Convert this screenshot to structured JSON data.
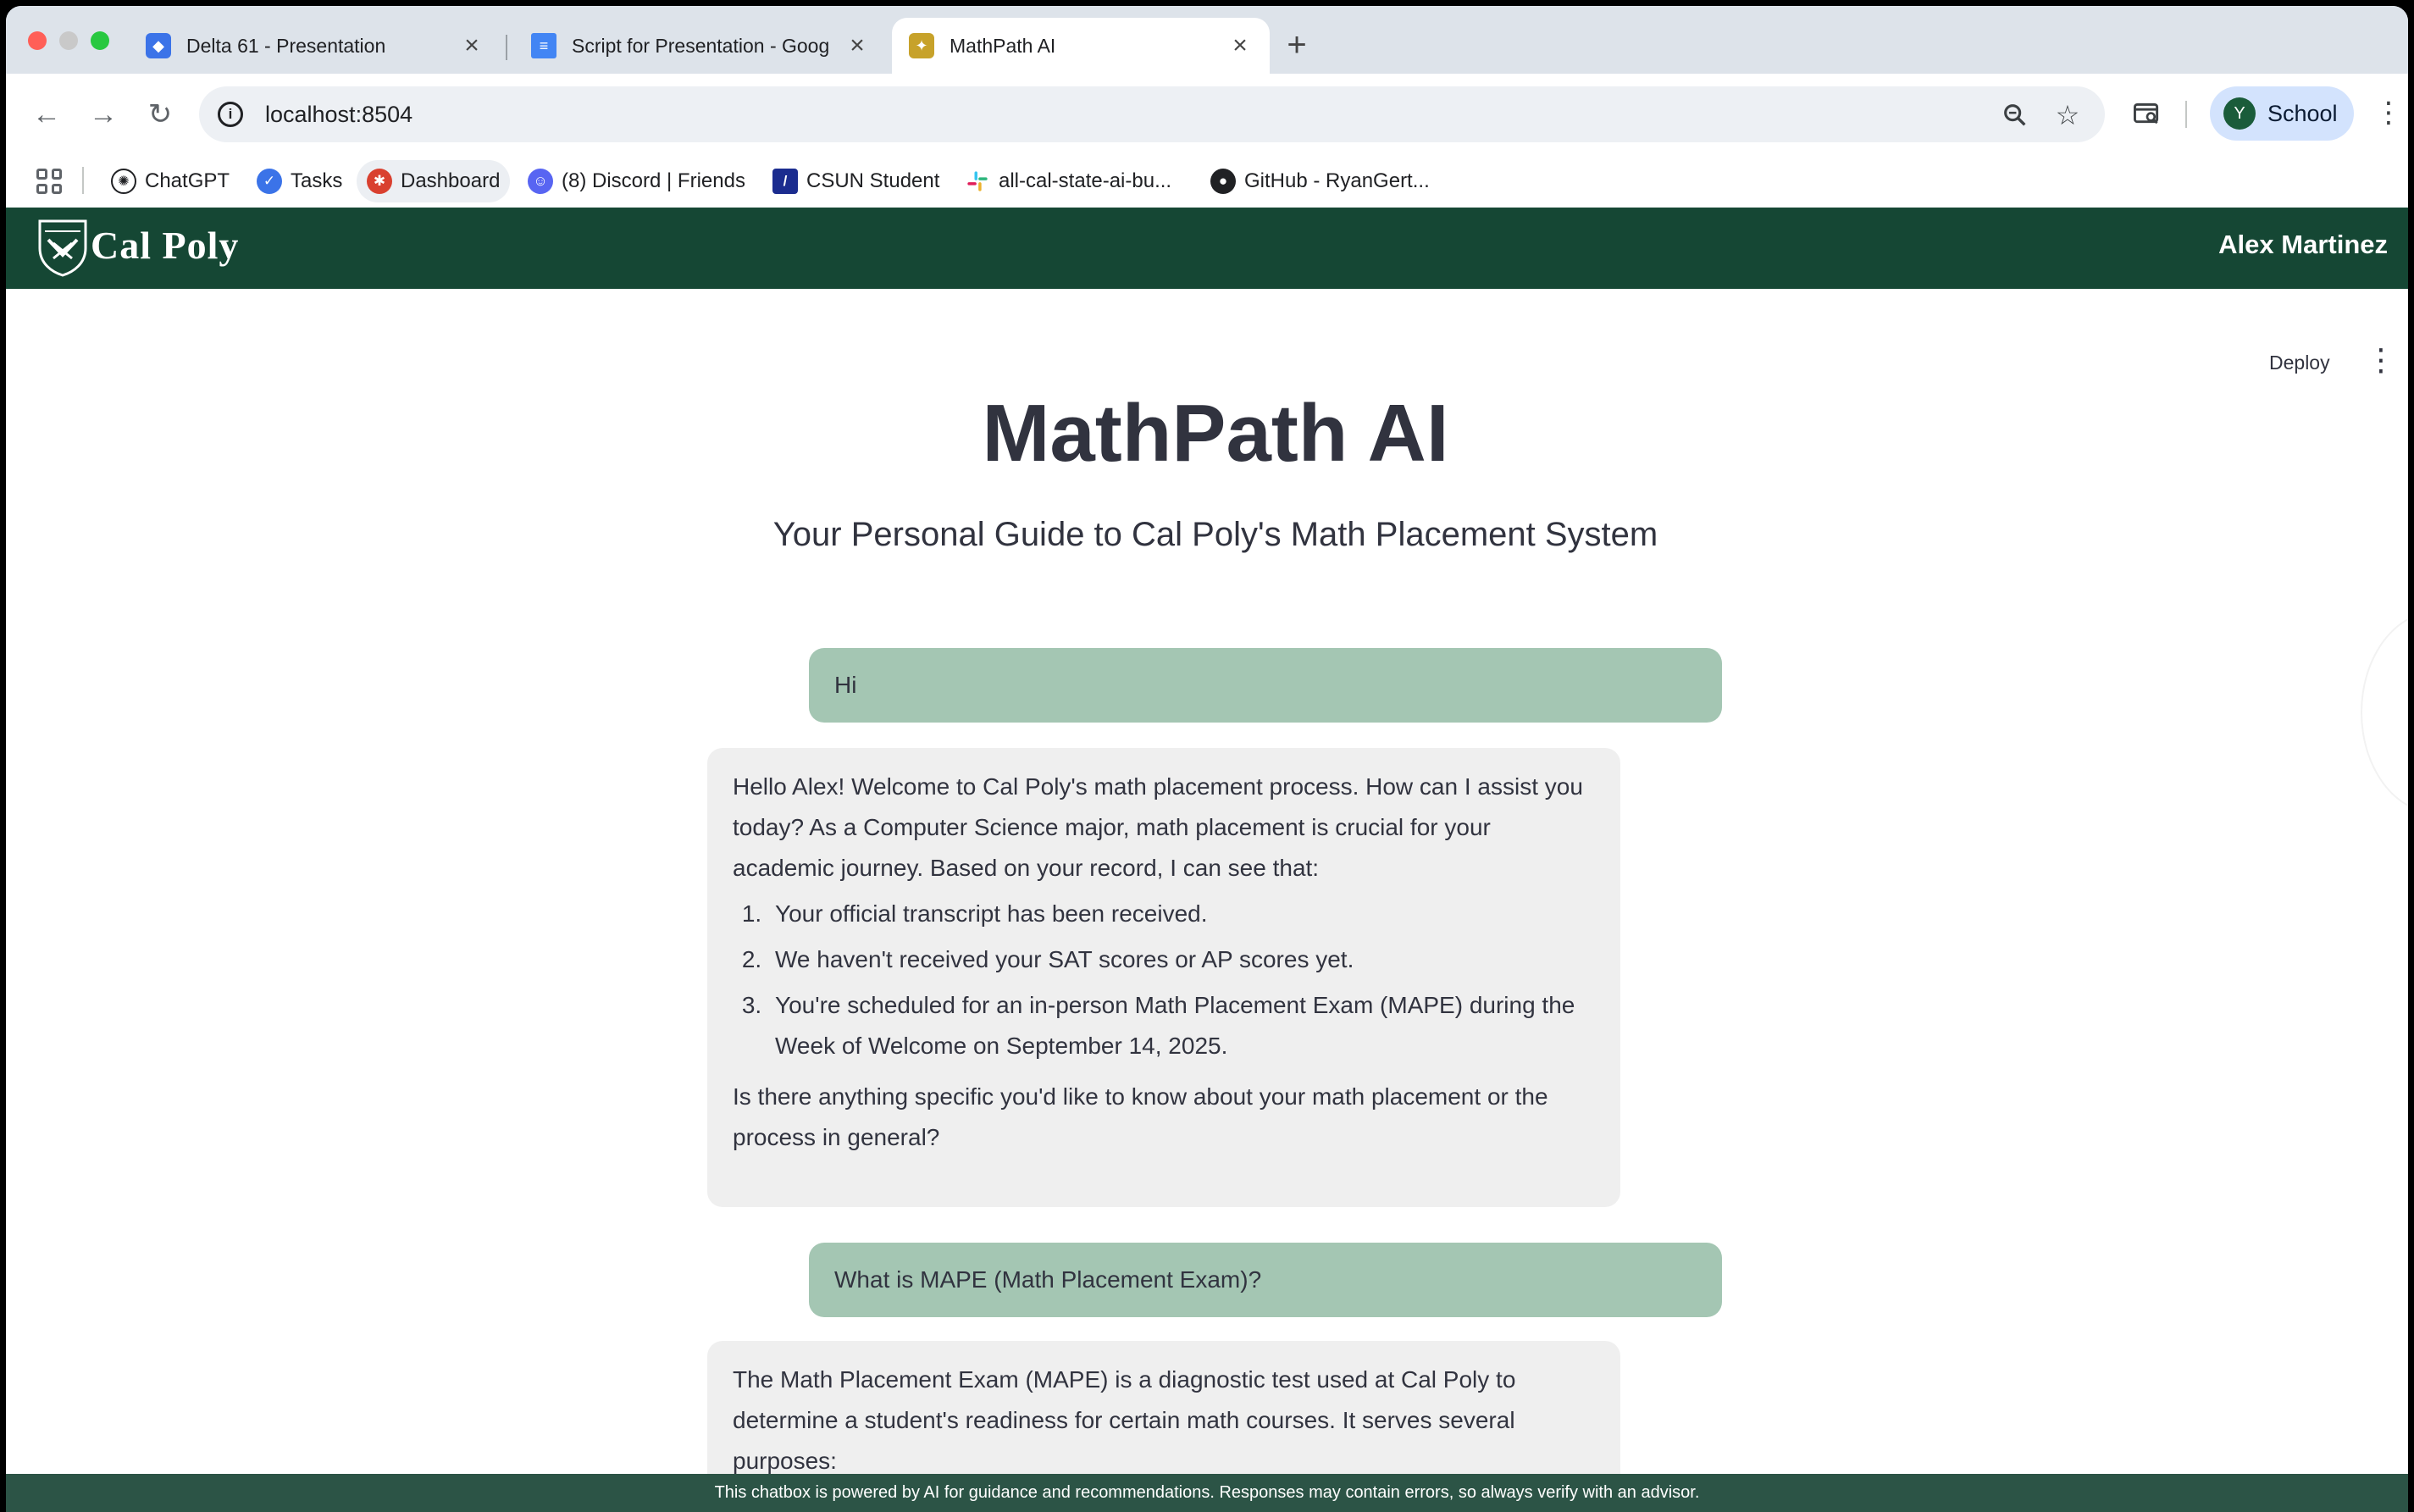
{
  "browser": {
    "tabs": [
      {
        "title": "Delta 61 - Presentation",
        "icon": "delta-app-icon",
        "color": "#3b73e8"
      },
      {
        "title": "Script for Presentation - Goog",
        "icon": "google-docs-icon",
        "color": "#4285f4"
      },
      {
        "title": "MathPath AI",
        "icon": "calpoly-favicon",
        "color": "#c7a22a"
      }
    ],
    "url": "localhost:8504",
    "profile": {
      "initial": "Y",
      "label": "School"
    },
    "bookmarks": [
      {
        "label": "ChatGPT",
        "icon": "chatgpt-icon"
      },
      {
        "label": "Tasks",
        "icon": "tasks-icon"
      },
      {
        "label": "Dashboard",
        "icon": "dashboard-icon"
      },
      {
        "label": "(8) Discord | Friends",
        "icon": "discord-icon"
      },
      {
        "label": "CSUN Student",
        "icon": "csun-icon"
      },
      {
        "label": "all-cal-state-ai-bu...",
        "icon": "slack-icon"
      },
      {
        "label": "GitHub - RyanGert...",
        "icon": "github-icon"
      }
    ]
  },
  "site": {
    "logo_text": "Cal Poly",
    "user_name": "Alex Martinez",
    "brand_color": "#154734"
  },
  "app": {
    "deploy_label": "Deploy",
    "title": "MathPath AI",
    "subtitle": "Your Personal Guide to Cal Poly's Math Placement System"
  },
  "chat": {
    "user_1": "Hi",
    "ai_1": {
      "intro": "Hello Alex! Welcome to Cal Poly's math placement process. How can I assist you today? As a Computer Science major, math placement is crucial for your academic journey. Based on your record, I can see that:",
      "items": [
        "Your official transcript has been received.",
        "We haven't received your SAT scores or AP scores yet.",
        "You're scheduled for an in-person Math Placement Exam (MAPE) during the Week of Welcome on September 14, 2025."
      ],
      "closing": "Is there anything specific you'd like to know about your math placement or the process in general?"
    },
    "user_2": "What is MAPE (Math Placement Exam)?",
    "ai_2": {
      "text": "The Math Placement Exam (MAPE) is a diagnostic test used at Cal Poly to determine a student's readiness for certain math courses. It serves several purposes:"
    }
  },
  "footer": {
    "disclaimer": "This chatbox is powered by AI for guidance and recommendations. Responses may contain errors, so always verify with an advisor."
  }
}
